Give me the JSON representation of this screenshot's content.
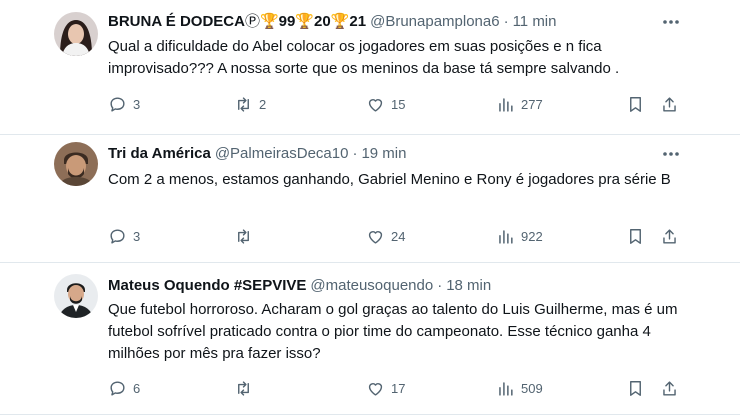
{
  "tweets": [
    {
      "name": "BRUNA É DODECAⓅ99🏆20🏆21",
      "name_display": "BRUNA É DODECA",
      "name_badge": "Ⓟ",
      "name_trophy_1": "🏆",
      "name_num_1": "99",
      "name_trophy_2": "🏆",
      "name_num_2": "20",
      "name_trophy_3": "🏆",
      "name_num_3": "21",
      "handle": "@Brunapamplona6",
      "time": "11 min",
      "text": "Qual a dificuldade do Abel colocar os jogadores em suas posições e n fica improvisado??? A nossa sorte que os meninos da base tá sempre salvando .",
      "replies": "3",
      "retweets": "2",
      "likes": "15",
      "views": "277",
      "avatar_colors": [
        "#d8d0cf",
        "#2a1d1a",
        "#e8c6b0"
      ]
    },
    {
      "name": "Tri da América",
      "handle": "@PalmeirasDeca10",
      "time": "19 min",
      "text": "Com 2 a menos, estamos ganhando, Gabriel Menino e Rony é jogadores pra série B",
      "replies": "3",
      "retweets": "",
      "likes": "24",
      "views": "922",
      "avatar_colors": [
        "#8d6e57",
        "#3b2b21",
        "#c99a78"
      ]
    },
    {
      "name": "Mateus Oquendo #SEPVIVE",
      "handle": "@mateusoquendo",
      "time": "18 min",
      "text": "Que futebol horroroso. Acharam o gol graças ao talento do Luis Guilherme, mas é um futebol sofrível praticado contra o pior time do campeonato. Esse técnico ganha 4 milhões por mês pra fazer isso?",
      "replies": "6",
      "retweets": "",
      "likes": "17",
      "views": "509",
      "avatar_colors": [
        "#e9ecef",
        "#1c1c1c",
        "#d6a88a"
      ]
    }
  ],
  "separator": "·",
  "colors": {
    "text": "#0f1419",
    "secondary": "#536471",
    "divider": "#e1e8ed"
  },
  "icons": {
    "reply": "reply-icon",
    "retweet": "retweet-icon",
    "like": "like-icon",
    "views": "views-icon",
    "bookmark": "bookmark-icon",
    "share": "share-icon",
    "more": "more-icon"
  }
}
